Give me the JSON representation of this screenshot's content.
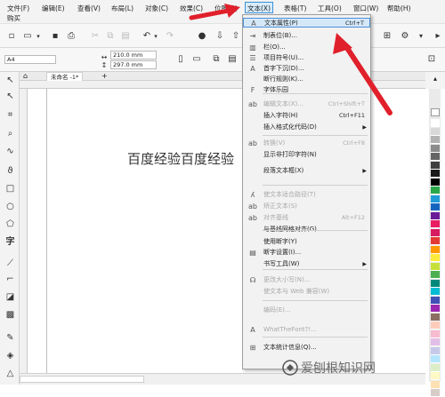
{
  "menubar": {
    "items": [
      "文件(F)",
      "编辑(E)",
      "查看(V)",
      "布局(L)",
      "对象(C)",
      "效果(C)",
      "位图(B)",
      "文本(X)",
      "表格(T)",
      "工具(O)",
      "窗口(W)",
      "帮助(H)"
    ],
    "second_row": "购买"
  },
  "toolbar": {
    "page_size": "A4",
    "width_value": "210.0 mm",
    "height_value": "297.0 mm"
  },
  "document": {
    "tab_label": "未命名 -1*",
    "add_tab": "+",
    "text": "百度经验百度经验"
  },
  "text_menu": {
    "items": [
      {
        "label": "文本属性(P)",
        "shortcut": "Ctrl+T",
        "icon": "text-properties-icon",
        "glyph": "A",
        "highlighted": true,
        "disabled": false
      },
      {
        "label": "制表位(B)...",
        "icon": "tab-stop-icon",
        "glyph": "⇥",
        "disabled": false
      },
      {
        "label": "栏(O)...",
        "icon": "columns-icon",
        "glyph": "▥",
        "disabled": false
      },
      {
        "label": "项目符号(U)...",
        "icon": "bullets-icon",
        "glyph": "☰",
        "disabled": false
      },
      {
        "label": "首字下沉(D)...",
        "icon": "drop-cap-icon",
        "glyph": "A",
        "disabled": false
      },
      {
        "label": "断行规则(K)...",
        "disabled": false
      },
      {
        "label": "字体乐园",
        "icon": "font-playground-icon",
        "glyph": "F",
        "disabled": false
      },
      {
        "label": "编辑文本(X)...",
        "shortcut": "Ctrl+Shift+T",
        "icon": "edit-text-icon",
        "glyph": "ab",
        "disabled": true
      },
      {
        "label": "插入字符(H)",
        "shortcut": "Ctrl+F11",
        "disabled": false
      },
      {
        "label": "插入格式化代码(D)",
        "submenu": true,
        "disabled": false
      },
      {
        "label": "转换(V)",
        "shortcut": "Ctrl+F8",
        "icon": "convert-icon",
        "glyph": "ab",
        "disabled": true
      },
      {
        "label": "显示非打印字符(N)",
        "disabled": false
      },
      {
        "label": "段落文本框(X)",
        "submenu": true,
        "disabled": false
      },
      {
        "label": "使文本适合路径(T)",
        "icon": "fit-path-icon",
        "glyph": "ʎ",
        "disabled": true
      },
      {
        "label": "矫正文本(S)",
        "icon": "straighten-icon",
        "glyph": "ab",
        "disabled": true
      },
      {
        "label": "对齐基线",
        "shortcut": "Alt+F12",
        "icon": "baseline-icon",
        "glyph": "ab",
        "disabled": true
      },
      {
        "label": "与基线网格对齐(G)",
        "disabled": false
      },
      {
        "label": "使用断字(Y)",
        "disabled": false
      },
      {
        "label": "断字设置(I)...",
        "icon": "hyphen-icon",
        "glyph": "▤",
        "disabled": false
      },
      {
        "label": "书写工具(W)",
        "submenu": true,
        "disabled": false
      },
      {
        "label": "更改大小写(N)...",
        "icon": "change-case-icon",
        "glyph": "☊",
        "disabled": true
      },
      {
        "label": "使文本与 Web 兼容(W)",
        "disabled": true
      },
      {
        "label": "编码(E)...",
        "disabled": true
      },
      {
        "label": "WhatTheFont?!...",
        "icon": "whatthefont-icon",
        "glyph": "A",
        "disabled": true
      },
      {
        "label": "文本统计信息(Q)...",
        "icon": "statistics-icon",
        "glyph": "⊞",
        "disabled": false
      }
    ]
  },
  "watermark": {
    "text": "爱刨根知识网"
  },
  "colors": {
    "menu_highlight": "#d5e8f8",
    "menu_highlight_border": "#4a90d8",
    "arrow_red": "#e0202a",
    "palette": [
      "#ffffff",
      "#d9d9d9",
      "#b3b3b3",
      "#8c8c8c",
      "#666666",
      "#404040",
      "#1a1a1a",
      "#000000",
      "#2aa84a",
      "#1f9cd8",
      "#1565c0",
      "#6a1b9a",
      "#e91e63",
      "#d81b60",
      "#e53935",
      "#ff9800",
      "#ffeb3b",
      "#c6e03a",
      "#4caf50",
      "#00897b",
      "#00bcd4",
      "#3f51b5",
      "#9c27b0",
      "#8d6e63",
      "#ffccbc",
      "#f8bbd0",
      "#e1bee7",
      "#c5cae9",
      "#b3e5fc",
      "#dcedc8",
      "#fff9c4",
      "#ffe0b2",
      "#d7ccc8"
    ]
  }
}
